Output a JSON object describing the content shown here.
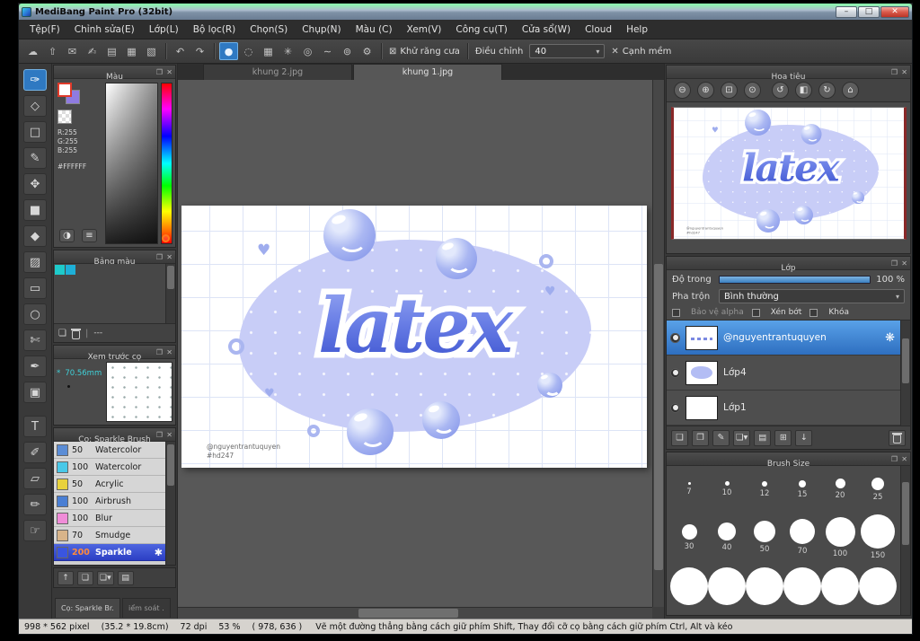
{
  "window": {
    "title": "MediBang Paint Pro (32bit)"
  },
  "menu": {
    "items": [
      "Tệp(F)",
      "Chỉnh sửa(E)",
      "Lớp(L)",
      "Bộ lọc(R)",
      "Chọn(S)",
      "Chụp(N)",
      "Màu (C)",
      "Xem(V)",
      "Công cụ(T)",
      "Cửa sổ(W)",
      "Cloud",
      "Help"
    ]
  },
  "toolbar": {
    "antialias_label": "Khử răng cưa",
    "adjust_label": "Điều chỉnh",
    "adjust_value": "40",
    "softedge_label": "Cạnh mềm"
  },
  "tabs": {
    "items": [
      "khung 2.jpg",
      "khung 1.jpg"
    ]
  },
  "color_panel": {
    "title": "Màu",
    "r": "R:255",
    "g": "G:255",
    "b": "B:255",
    "hex": "#FFFFFF"
  },
  "palette": {
    "title": "Bảng màu",
    "empty_label": "---"
  },
  "brush_preview": {
    "title": "Xem trước cọ",
    "size_prefix": "*",
    "size_label": "70.56mm"
  },
  "brush_panel": {
    "title": "Cọ: Sparkle Brush",
    "brushes": [
      {
        "size": "50",
        "name": "Watercolor",
        "color": "#5b8dd6"
      },
      {
        "size": "100",
        "name": "Watercolor",
        "color": "#49c8e8"
      },
      {
        "size": "50",
        "name": "Acrylic",
        "color": "#e8d23c"
      },
      {
        "size": "100",
        "name": "Airbrush",
        "color": "#4a7fd4"
      },
      {
        "size": "100",
        "name": "Blur",
        "color": "#f08cd8"
      },
      {
        "size": "70",
        "name": "Smudge",
        "color": "#d8b48a"
      },
      {
        "size": "200",
        "name": "Sparkle",
        "color": "#3a55e0"
      }
    ],
    "dock_tabs": [
      "Cọ: Sparkle Br.",
      "iểm soát ."
    ]
  },
  "navigator": {
    "title": "Hoa tiêu"
  },
  "layers": {
    "title": "Lớp",
    "opacity_label": "Độ trong",
    "opacity_value": "100 %",
    "blend_label": "Pha trộn",
    "blend_value": "Bình thường",
    "check_alpha": "Bảo vệ alpha",
    "check_clip": "Xén bớt",
    "check_lock": "Khóa",
    "items": [
      {
        "name": "@nguyentrantuquyen",
        "selected": true
      },
      {
        "name": "Lớp4"
      },
      {
        "name": "Lớp1"
      }
    ]
  },
  "brush_sizes": {
    "title": "Brush Size",
    "sizes": [
      "7",
      "10",
      "12",
      "15",
      "20",
      "25",
      "30",
      "40",
      "50",
      "70",
      "100",
      "150"
    ]
  },
  "canvas": {
    "artwork_text": "latex",
    "credit1": "@nguyentrantuquyen",
    "credit2": "#hd247"
  },
  "status": {
    "segments": [
      "998 * 562 pixel",
      "(35.2 * 19.8cm)",
      "72 dpi",
      "53 %",
      "( 978, 636 )"
    ],
    "help": "Vẽ một đường thẳng bằng cách giữ phím Shift, Thay đổi cỡ cọ bằng cách giữ phím Ctrl, Alt và kéo"
  },
  "accent_colors": {
    "selection_blue": "#2f79c2",
    "layer_selected": "#2e6fc0",
    "brush_selected": "#2c3fc4"
  },
  "icons": {
    "win_min": "–",
    "win_max": "□",
    "win_close": "✕",
    "panel_popout": "❐",
    "panel_close": "✕",
    "dropdown_arrow": "▾",
    "file": [
      "☁",
      "⇧",
      "✉",
      "✍",
      "▤",
      "▦",
      "▧"
    ],
    "undo": "↶",
    "redo": "↷",
    "brush_modes": [
      "●",
      "◌",
      "▦",
      "✳",
      "◎",
      "∼",
      "⊚",
      "⚙"
    ],
    "antialias_check": "⊠",
    "softedge_x": "✕",
    "tools": [
      "✑",
      "◇",
      "□",
      "✎",
      "✥",
      "■",
      "◆",
      "▨",
      "▭",
      "○",
      "✄",
      "✒",
      "▣",
      "T",
      "✐",
      "▱",
      "✏",
      "☞"
    ],
    "nav": [
      "⊖",
      "⊕",
      "⊡",
      "⊙",
      "↺",
      "◧",
      "↻",
      "⌂"
    ],
    "layer_tools": [
      "❏",
      "❐",
      "✎",
      "❏▾",
      "▤",
      "⊞",
      "↓"
    ],
    "brush_footer": [
      "↑",
      "❏",
      "❏▾",
      "▤"
    ],
    "palette_new": "❏",
    "color_wheel": "◑",
    "color_sliders": "≡",
    "gear_sparkle": "✱",
    "gear_layer": "❋"
  }
}
